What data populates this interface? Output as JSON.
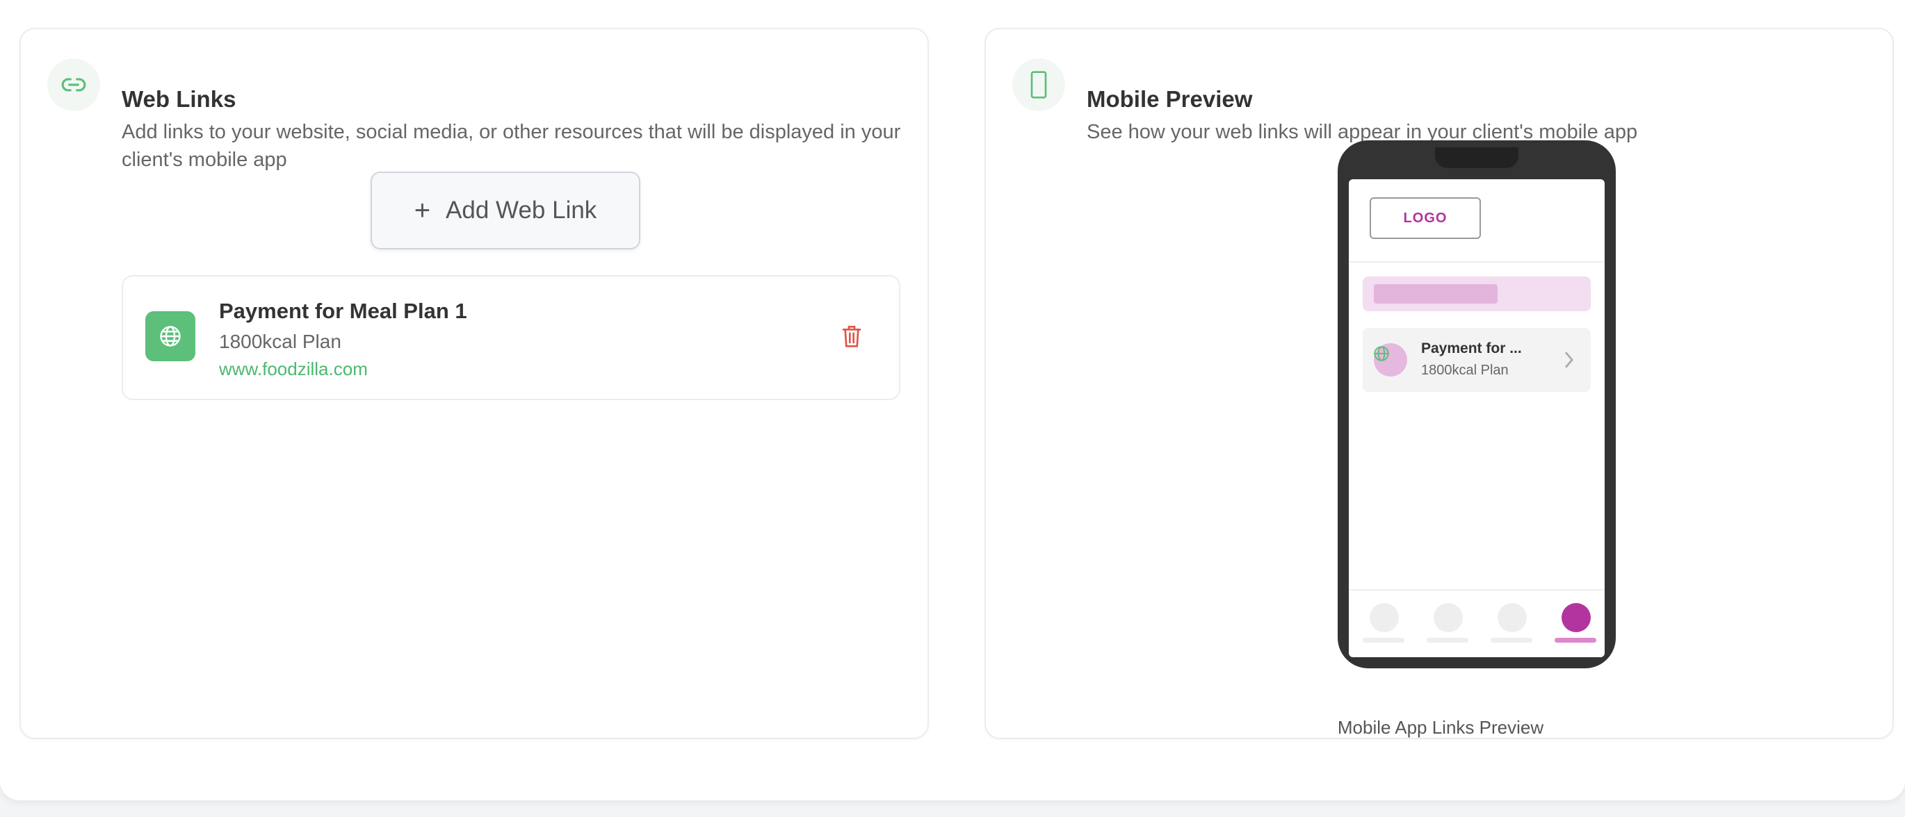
{
  "web_links": {
    "title": "Web Links",
    "description": "Add links to your website, social media, or other resources that will be displayed in your client's mobile app",
    "add_button_label": "Add Web Link",
    "items": [
      {
        "title": "Payment for Meal Plan 1",
        "subtitle": "1800kcal Plan",
        "url": "www.foodzilla.com"
      }
    ]
  },
  "mobile_preview": {
    "title": "Mobile Preview",
    "description": "See how your web links will appear in your client's mobile app",
    "logo_text": "LOGO",
    "item_title": "Payment for ...",
    "item_subtitle": "1800kcal Plan",
    "caption": "Mobile App Links Preview"
  },
  "colors": {
    "accent_green": "#5cbf7a",
    "accent_magenta": "#b3349e",
    "danger_red": "#e05545"
  }
}
